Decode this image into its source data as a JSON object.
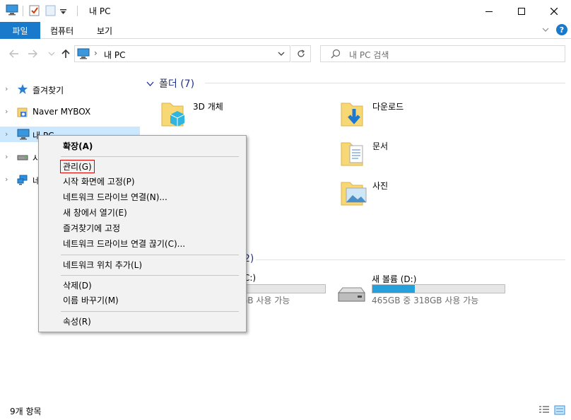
{
  "window": {
    "title": "내 PC"
  },
  "ribbon": {
    "tabs": [
      "파일",
      "컴퓨터",
      "보기"
    ]
  },
  "address": {
    "path": "내 PC"
  },
  "search": {
    "placeholder": "내 PC 검색"
  },
  "nav_pane": {
    "items": [
      {
        "label": "즐겨찾기",
        "icon": "star-icon"
      },
      {
        "label": "Naver MYBOX",
        "icon": "mybox-icon"
      },
      {
        "label": "내 PC",
        "icon": "computer-icon",
        "selected": true
      },
      {
        "label": "시",
        "icon": "drive-icon"
      },
      {
        "label": "네",
        "icon": "network-icon"
      }
    ]
  },
  "main": {
    "folders_header": "폴더 (7)",
    "folders": [
      {
        "label": "3D 개체",
        "icon": "folder-3d-icon"
      },
      {
        "label": "다운로드",
        "icon": "folder-download-icon"
      },
      {
        "label": "문서",
        "icon": "folder-documents-icon"
      },
      {
        "label": "사진",
        "icon": "folder-pictures-icon"
      }
    ],
    "drives_header_tail": "2)",
    "drives": [
      {
        "label": "C:)",
        "free_text": "GB 사용 가능",
        "used_fraction": 0
      },
      {
        "label": "새 볼륨 (D:)",
        "free_text": "465GB 중 318GB 사용 가능",
        "used_fraction": 0.32
      }
    ]
  },
  "context_menu": {
    "items": [
      {
        "label": "확장(A)",
        "bold": true
      },
      {
        "label": "관리(G)",
        "highlighted": true
      },
      {
        "label": "시작 화면에 고정(P)"
      },
      {
        "label": "네트워크 드라이브 연결(N)..."
      },
      {
        "label": "새 창에서 열기(E)"
      },
      {
        "label": "즐겨찾기에 고정"
      },
      {
        "label": "네트워크 드라이브 연결 끊기(C)..."
      },
      {
        "label": "네트워크 위치 추가(L)"
      },
      {
        "label": "삭제(D)"
      },
      {
        "label": "이름 바꾸기(M)"
      },
      {
        "label": "속성(R)"
      }
    ]
  },
  "status_bar": {
    "item_count": "9개 항목"
  },
  "colors": {
    "accent": "#1979ca",
    "selection": "#cce8ff",
    "header_text": "#1e3287",
    "drive_fill": "#26a0da",
    "highlight_border": "#e00000"
  }
}
